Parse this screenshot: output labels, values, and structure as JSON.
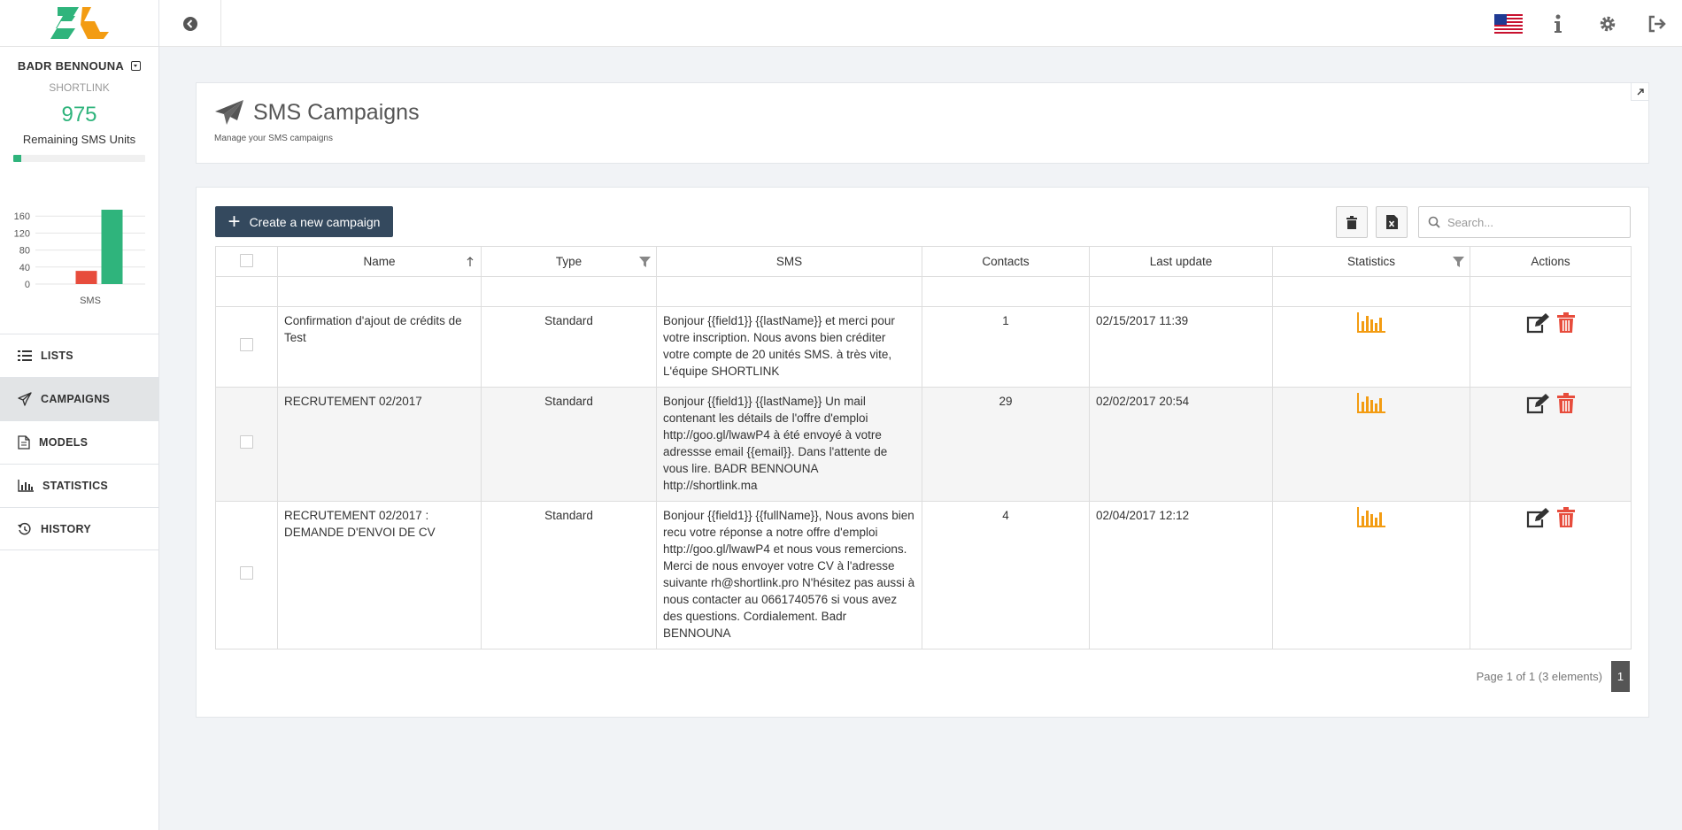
{
  "sidebar": {
    "user_name": "BADR BENNOUNA",
    "company": "SHORTLINK",
    "remaining_units": "975",
    "remaining_label": "Remaining SMS Units",
    "progress_percent": 6,
    "nav": [
      {
        "label": "LISTS"
      },
      {
        "label": "CAMPAIGNS"
      },
      {
        "label": "MODELS"
      },
      {
        "label": "STATISTICS"
      },
      {
        "label": "HISTORY"
      }
    ]
  },
  "chart_data": {
    "type": "bar",
    "categories": [
      "SMS"
    ],
    "series": [
      {
        "values": [
          31
        ],
        "color": "#e74c3c"
      },
      {
        "values": [
          175
        ],
        "color": "#2fb47c"
      }
    ],
    "yticks": [
      0,
      40,
      80,
      120,
      160
    ],
    "ylim": [
      0,
      175
    ],
    "xlabel": "SMS",
    "grid": true
  },
  "header": {
    "title": "SMS Campaigns",
    "subtitle": "Manage your SMS campaigns"
  },
  "toolbar": {
    "create_label": "Create a new campaign",
    "search_placeholder": "Search..."
  },
  "table": {
    "columns": {
      "name": "Name",
      "type": "Type",
      "sms": "SMS",
      "contacts": "Contacts",
      "last_update": "Last update",
      "statistics": "Statistics",
      "actions": "Actions"
    },
    "rows": [
      {
        "name": "Confirmation d'ajout de crédits de Test",
        "type": "Standard",
        "sms": "Bonjour {{field1}} {{lastName}} et merci pour votre inscription. Nous avons bien créditer votre compte de 20 unités SMS. à très vite, L'équipe SHORTLINK",
        "contacts": "1",
        "last_update": "02/15/2017 11:39"
      },
      {
        "name": "RECRUTEMENT 02/2017",
        "type": "Standard",
        "sms": "Bonjour {{field1}} {{lastName}} Un mail contenant les détails de l'offre d'emploi http://goo.gl/lwawP4 à été envoyé à votre adressse email {{email}}. Dans l'attente de vous lire. BADR BENNOUNA http://shortlink.ma",
        "contacts": "29",
        "last_update": "02/02/2017 20:54"
      },
      {
        "name": "RECRUTEMENT 02/2017 : DEMANDE D'ENVOI DE CV",
        "type": "Standard",
        "sms": "Bonjour {{field1}} {{fullName}}, Nous avons bien recu votre réponse a notre offre d'emploi http://goo.gl/lwawP4 et nous vous remercions. Merci de nous envoyer votre CV à l'adresse suivante rh@shortlink.pro N'hésitez pas aussi à nous contacter au 0661740576 si vous avez des questions. Cordialement. Badr BENNOUNA",
        "contacts": "4",
        "last_update": "02/04/2017 12:12"
      }
    ]
  },
  "pagination": {
    "summary": "Page 1 of 1 (3 elements)",
    "current": "1"
  },
  "colors": {
    "accent_green": "#2fb47c",
    "primary_dark": "#34495e",
    "stats_orange": "#f39c12",
    "delete_red": "#e74c3c"
  }
}
